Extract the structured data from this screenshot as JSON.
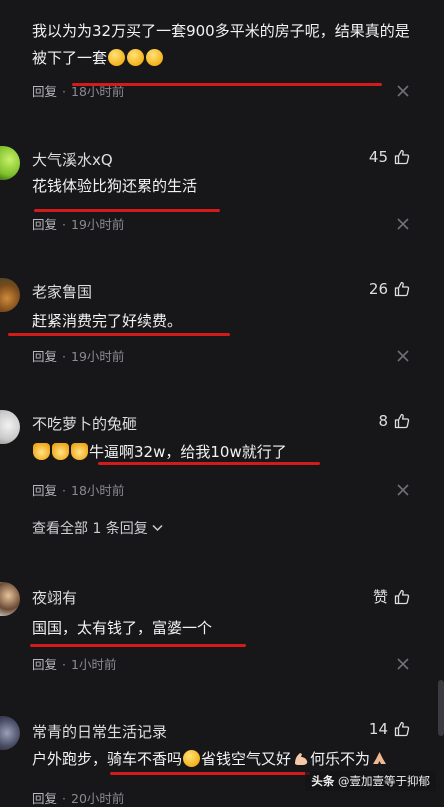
{
  "comments": [
    {
      "text": "我以为为32万买了一套900多平米的房子呢，结果真的是被下了一套",
      "reply_label": "回复",
      "time": "18小时前"
    },
    {
      "name": "大气溪水xQ",
      "likes": "45",
      "text": "花钱体验比狗还累的生活",
      "reply_label": "回复",
      "time": "19小时前"
    },
    {
      "name": "老家鲁国",
      "likes": "26",
      "text": "赶紧消费完了好续费。",
      "reply_label": "回复",
      "time": "19小时前"
    },
    {
      "name": "不吃萝卜的兔砸",
      "likes": "8",
      "text": "牛逼啊32w，给我10w就行了",
      "reply_label": "回复",
      "time": "18小时前",
      "view_replies": "查看全部 1 条回复"
    },
    {
      "name": "夜翊有",
      "likes": "赞",
      "text": "国国，太有钱了，富婆一个",
      "reply_label": "回复",
      "time": "1小时前"
    },
    {
      "name": "常青的日常生活记录",
      "likes": "14",
      "text_part1": "户外跑步，骑车不香吗",
      "text_part2": "省钱空气又好",
      "text_part3": "何乐不为",
      "reply_label": "回复",
      "time": "20小时前"
    }
  ],
  "separator": "·",
  "watermark": {
    "platform": "头条",
    "author": "@壹加壹等于抑郁"
  },
  "colors": {
    "background": "#17171a",
    "underline": "#d41b1b"
  },
  "icons": {
    "like": "thumbs-up-icon",
    "close": "close-icon",
    "expand": "chevron-down-icon"
  }
}
